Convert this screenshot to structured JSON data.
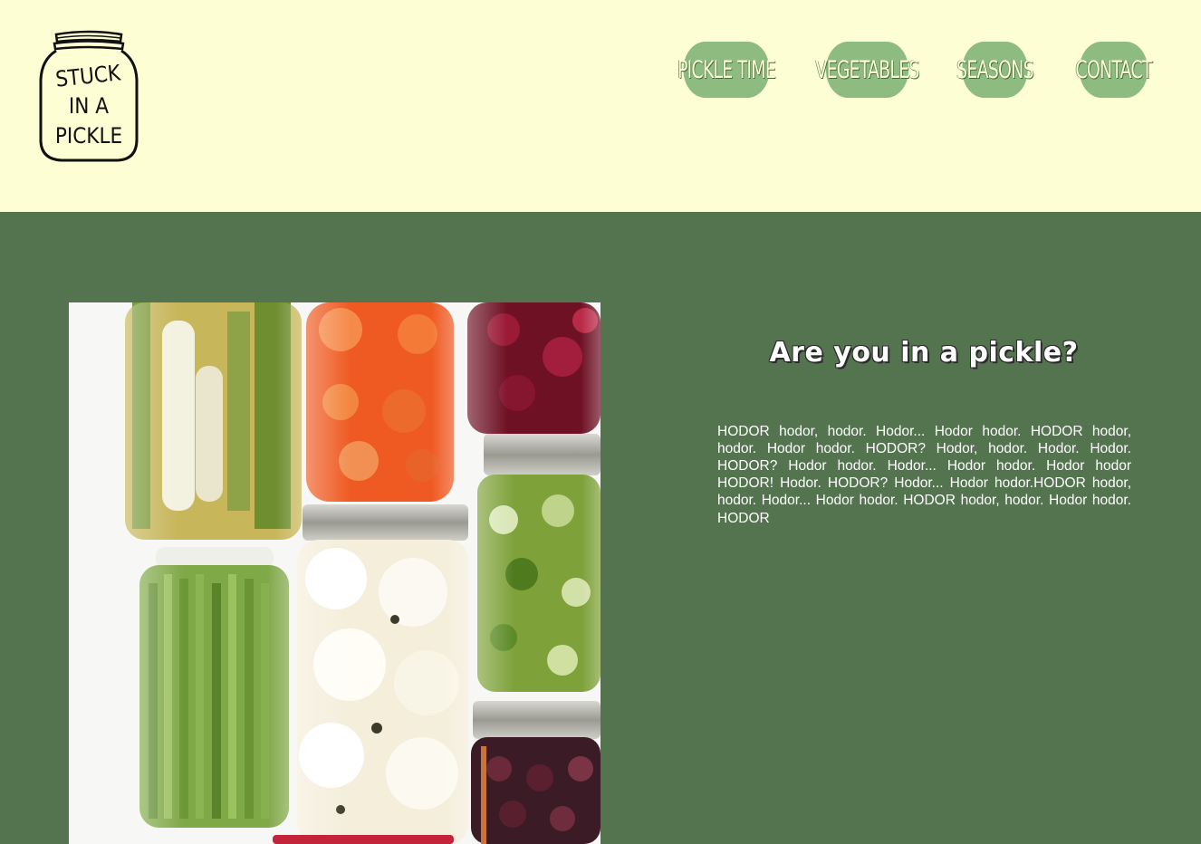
{
  "logo": {
    "lines": [
      "STUCK",
      "IN A",
      "PICKLE"
    ]
  },
  "nav": {
    "items": [
      {
        "label": "PICKLE TIME"
      },
      {
        "label": "VEGETABLES"
      },
      {
        "label": "SEASONS"
      },
      {
        "label": "CONTACT"
      }
    ]
  },
  "hero": {
    "title": "Are you in a pickle?",
    "body": "HODOR hodor, hodor. Hodor... Hodor hodor. HODOR hodor, hodor. Hodor hodor. HODOR? Hodor, hodor. Hodor. Hodor. HODOR? Hodor hodor. Hodor... Hodor hodor. Hodor hodor HODOR! Hodor. HODOR? Hodor... Hodor hodor.HODOR hodor, hodor. Hodor... Hodor hodor. HODOR hodor, hodor. Hodor hodor. HODOR"
  },
  "colors": {
    "header_bg": "#fefed4",
    "main_bg": "#53744f",
    "nav_button": "#8dbb80",
    "text_light": "#ffffff"
  }
}
